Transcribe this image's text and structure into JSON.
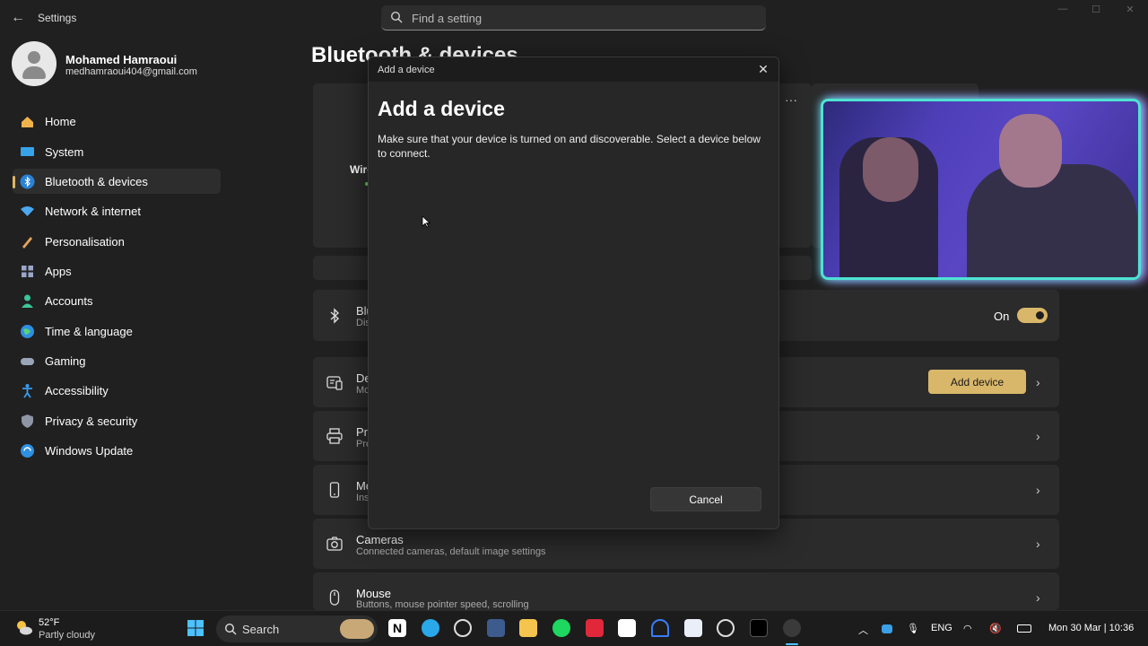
{
  "window": {
    "app_title": "Settings",
    "search_placeholder": "Find a setting"
  },
  "profile": {
    "name": "Mohamed Hamraoui",
    "email": "medhamraoui404@gmail.com"
  },
  "nav": {
    "items": [
      {
        "label": "Home",
        "icon": "home-icon",
        "active": false
      },
      {
        "label": "System",
        "icon": "system-icon",
        "active": false
      },
      {
        "label": "Bluetooth & devices",
        "icon": "bluetooth-icon",
        "active": true
      },
      {
        "label": "Network & internet",
        "icon": "wifi-icon",
        "active": false
      },
      {
        "label": "Personalisation",
        "icon": "brush-icon",
        "active": false
      },
      {
        "label": "Apps",
        "icon": "apps-icon",
        "active": false
      },
      {
        "label": "Accounts",
        "icon": "accounts-icon",
        "active": false
      },
      {
        "label": "Time & language",
        "icon": "globe-clock-icon",
        "active": false
      },
      {
        "label": "Gaming",
        "icon": "gamepad-icon",
        "active": false
      },
      {
        "label": "Accessibility",
        "icon": "accessibility-icon",
        "active": false
      },
      {
        "label": "Privacy & security",
        "icon": "shield-icon",
        "active": false
      },
      {
        "label": "Windows Update",
        "icon": "update-icon",
        "active": false
      }
    ]
  },
  "main": {
    "title": "Bluetooth & devices",
    "wireless_label_partial": "Wire",
    "rows": {
      "bluetooth": {
        "title_partial": "Blu",
        "sub_partial": "Dis",
        "toggle_label": "On",
        "toggle_on": true
      },
      "devices": {
        "title_partial": "De",
        "sub_partial": "Mo",
        "button": "Add device"
      },
      "printers": {
        "title_partial": "Pri",
        "sub_partial": "Pre"
      },
      "mobile": {
        "title_partial": "Mo",
        "sub_partial": "Ins"
      },
      "cameras": {
        "title": "Cameras",
        "sub": "Connected cameras, default image settings"
      },
      "mouse": {
        "title": "Mouse",
        "sub": "Buttons, mouse pointer speed, scrolling"
      }
    }
  },
  "dialog": {
    "window_title": "Add a device",
    "heading": "Add a device",
    "description": "Make sure that your device is turned on and discoverable. Select a device below to connect.",
    "cancel": "Cancel"
  },
  "taskbar": {
    "weather_temp": "52°F",
    "weather_desc": "Partly cloudy",
    "search_label": "Search",
    "language": "ENG",
    "datetime": "Mon 30 Mar | 10:36"
  },
  "colors": {
    "accent": "#d9b76a",
    "background": "#202020",
    "card": "#2b2b2b"
  }
}
